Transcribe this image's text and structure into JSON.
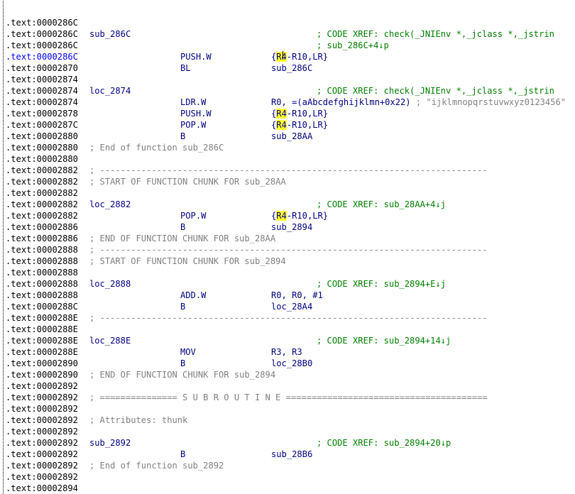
{
  "lines": [
    {
      "addr": ".text:0000286C"
    },
    {
      "addr": ".text:0000286C",
      "label": "sub_286C",
      "xref": "; CODE XREF: check(_JNIEnv *,_jclass *,_jstrin"
    },
    {
      "addr": ".text:0000286C",
      "xref": "; sub_286C+4↓p"
    },
    {
      "addr": ".text:0000286C",
      "sel": true,
      "mnem": "PUSH.W",
      "op_pre": "{",
      "op_hl": "R4",
      "op_post": "-R10,LR}",
      "cursor": true
    },
    {
      "addr": ".text:00002870",
      "mnem": "BL",
      "op_post": "sub_286C"
    },
    {
      "addr": ".text:00002874"
    },
    {
      "addr": ".text:00002874",
      "label": "loc_2874",
      "xref": "; CODE XREF: check(_JNIEnv *,_jclass *,_jstrin"
    },
    {
      "addr": ".text:00002874",
      "mnem": "LDR.W",
      "op_post": "R0, =(aAbcdefghijklmn+0x22)",
      "str": " ; \"ijklmnopqrstuvwxyz0123456\""
    },
    {
      "addr": ".text:00002878",
      "mnem": "PUSH.W",
      "op_pre": "{",
      "op_hl": "R4",
      "op_post": "-R10,LR}"
    },
    {
      "addr": ".text:0000287C",
      "mnem": "POP.W",
      "op_pre": "{",
      "op_hl": "R4",
      "op_post": "-R10,LR}"
    },
    {
      "addr": ".text:00002880",
      "mnem": "B",
      "op_post": "sub_28AA"
    },
    {
      "addr": ".text:00002880",
      "fn_cmt": "; End of function sub_286C"
    },
    {
      "addr": ".text:00002880"
    },
    {
      "addr": ".text:00002882",
      "fn_cmt": "; ---------------------------------------------------------------------------"
    },
    {
      "addr": ".text:00002882",
      "fn_cmt": "; START OF FUNCTION CHUNK FOR sub_28AA"
    },
    {
      "addr": ".text:00002882"
    },
    {
      "addr": ".text:00002882",
      "label": "loc_2882",
      "xref": "; CODE XREF: sub_28AA+4↓j"
    },
    {
      "addr": ".text:00002882",
      "mnem": "POP.W",
      "op_pre": "{",
      "op_hl": "R4",
      "op_post": "-R10,LR}"
    },
    {
      "addr": ".text:00002886",
      "mnem": "B",
      "op_post": "sub_2894"
    },
    {
      "addr": ".text:00002886",
      "fn_cmt": "; END OF FUNCTION CHUNK FOR sub_28AA"
    },
    {
      "addr": ".text:00002888",
      "fn_cmt": "; ---------------------------------------------------------------------------"
    },
    {
      "addr": ".text:00002888",
      "fn_cmt": "; START OF FUNCTION CHUNK FOR sub_2894"
    },
    {
      "addr": ".text:00002888"
    },
    {
      "addr": ".text:00002888",
      "label": "loc_2888",
      "xref": "; CODE XREF: sub_2894+E↓j"
    },
    {
      "addr": ".text:00002888",
      "mnem": "ADD.W",
      "op_post": "R0, R0, #1"
    },
    {
      "addr": ".text:0000288C",
      "mnem": "B",
      "op_post": "loc_28A4"
    },
    {
      "addr": ".text:0000288E",
      "fn_cmt": "; ---------------------------------------------------------------------------"
    },
    {
      "addr": ".text:0000288E"
    },
    {
      "addr": ".text:0000288E",
      "label": "loc_288E",
      "xref": "; CODE XREF: sub_2894+14↓j"
    },
    {
      "addr": ".text:0000288E",
      "mnem": "MOV",
      "op_post": "R3, R3"
    },
    {
      "addr": ".text:00002890",
      "mnem": "B",
      "op_post": "loc_28B0"
    },
    {
      "addr": ".text:00002890",
      "fn_cmt": "; END OF FUNCTION CHUNK FOR sub_2894"
    },
    {
      "addr": ".text:00002892"
    },
    {
      "addr": ".text:00002892",
      "fn_cmt": "; =============== S U B R O U T I N E ======================================="
    },
    {
      "addr": ".text:00002892"
    },
    {
      "addr": ".text:00002892",
      "fn_cmt": "; Attributes: thunk"
    },
    {
      "addr": ".text:00002892"
    },
    {
      "addr": ".text:00002892",
      "label": "sub_2892",
      "xref": "; CODE XREF: sub_2894+20↓p"
    },
    {
      "addr": ".text:00002892",
      "mnem": "B",
      "op_post": "sub_28B6"
    },
    {
      "addr": ".text:00002892",
      "fn_cmt": "; End of function sub_2892"
    },
    {
      "addr": ".text:00002892"
    },
    {
      "addr": ".text:00002894"
    }
  ]
}
